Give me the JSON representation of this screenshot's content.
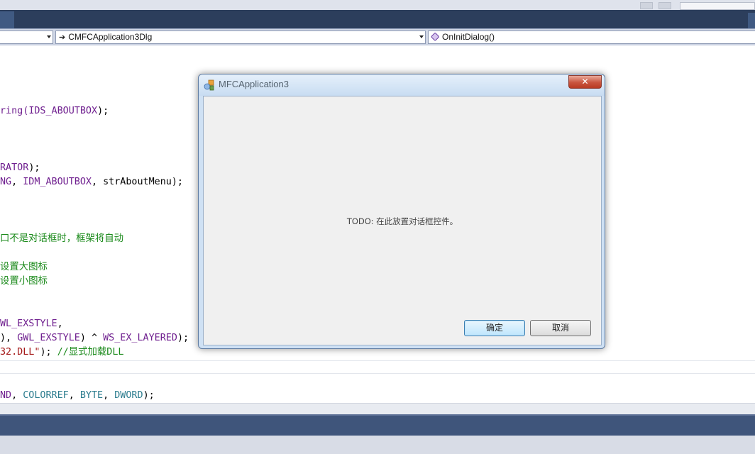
{
  "nav": {
    "scope_combo": "",
    "class_combo": "CMFCApplication3Dlg",
    "member_combo": "OnInitDialog()"
  },
  "code": {
    "l1a": "ring(",
    "l1b": "IDS_ABOUTBOX",
    "l1c": ");",
    "l2a": "RATOR",
    "l2b": ");",
    "l3a": "NG",
    "l3b": ", ",
    "l3c": "IDM_ABOUTBOX",
    "l3d": ", strAboutMenu);",
    "l4": "口不是对话框时，框架将自动",
    "l5": "设置大图标",
    "l6": "设置小图标",
    "l7a": "WL_EXSTYLE",
    "l7b": ",",
    "l8a": "), ",
    "l8b": "GWL_EXSTYLE",
    "l8c": ") ^ ",
    "l8d": "WS_EX_LAYERED",
    "l8e": ");",
    "l9a": "32.DLL\"",
    "l9b": "); ",
    "l9c": "//显式加载DLL",
    "l10a": "ND",
    "l10b": ", ",
    "l10c": "COLORREF",
    "l10d": ", ",
    "l10e": "BYTE",
    "l10f": ", ",
    "l10g": "DWORD",
    "l10h": ");"
  },
  "dialog": {
    "title": "MFCApplication3",
    "close_symbol": "✕",
    "todo_text": "TODO:  在此放置对话框控件。",
    "ok_label": "确定",
    "cancel_label": "取消"
  },
  "colors": {
    "keyword_purple": "#6f1f8f",
    "type_teal": "#2b7c8e",
    "comment_green": "#1b8a1b",
    "status_bar": "#3f557b"
  },
  "icons": {
    "dialog_icon": "mfc-app-icon",
    "class_glyph": "arrow-right-icon",
    "member_glyph": "method-icon"
  }
}
